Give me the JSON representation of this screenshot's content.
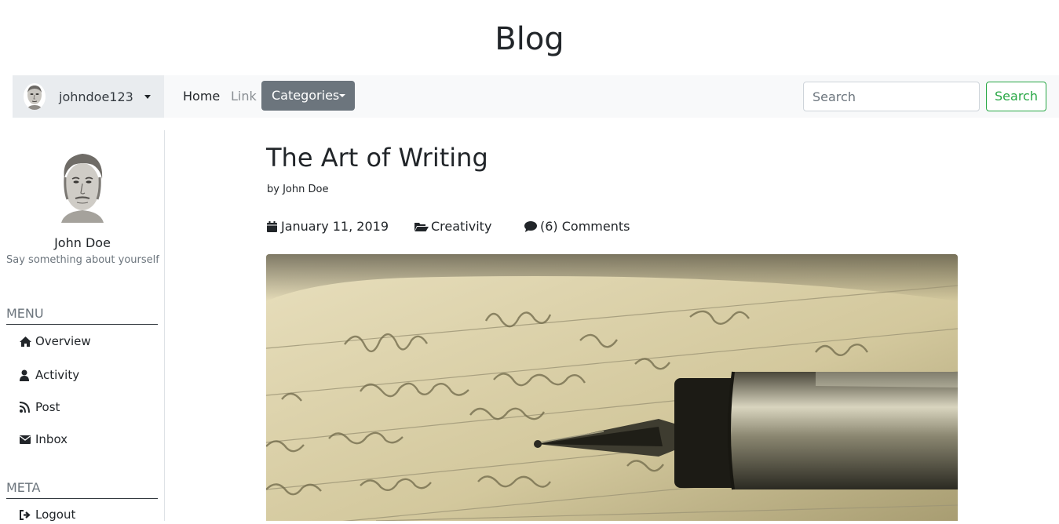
{
  "site": {
    "title": "Blog"
  },
  "navbar": {
    "username": "johndoe123",
    "links": {
      "home": "Home",
      "link": "Link"
    },
    "categories_label": "Categories",
    "search_placeholder": "Search",
    "search_button": "Search"
  },
  "sidebar": {
    "profile_name": "John Doe",
    "profile_bio": "Say something about yourself",
    "menu_heading": "MENU",
    "menu_items": [
      {
        "label": "Overview",
        "icon": "home-icon"
      },
      {
        "label": "Activity",
        "icon": "user-icon"
      },
      {
        "label": "Post",
        "icon": "rss-icon"
      },
      {
        "label": "Inbox",
        "icon": "envelope-icon"
      }
    ],
    "meta_heading": "META",
    "meta_items": [
      {
        "label": "Logout",
        "icon": "sign-out-icon"
      }
    ]
  },
  "post": {
    "title": "The Art of Writing",
    "author": "by John Doe",
    "date": "January 11, 2019",
    "category": "Creativity",
    "comments": "(6) Comments"
  },
  "colors": {
    "navbar_bg": "#f8f9fa",
    "secondary_button": "#6c757d",
    "success": "#28a745",
    "muted": "#6c757d"
  }
}
